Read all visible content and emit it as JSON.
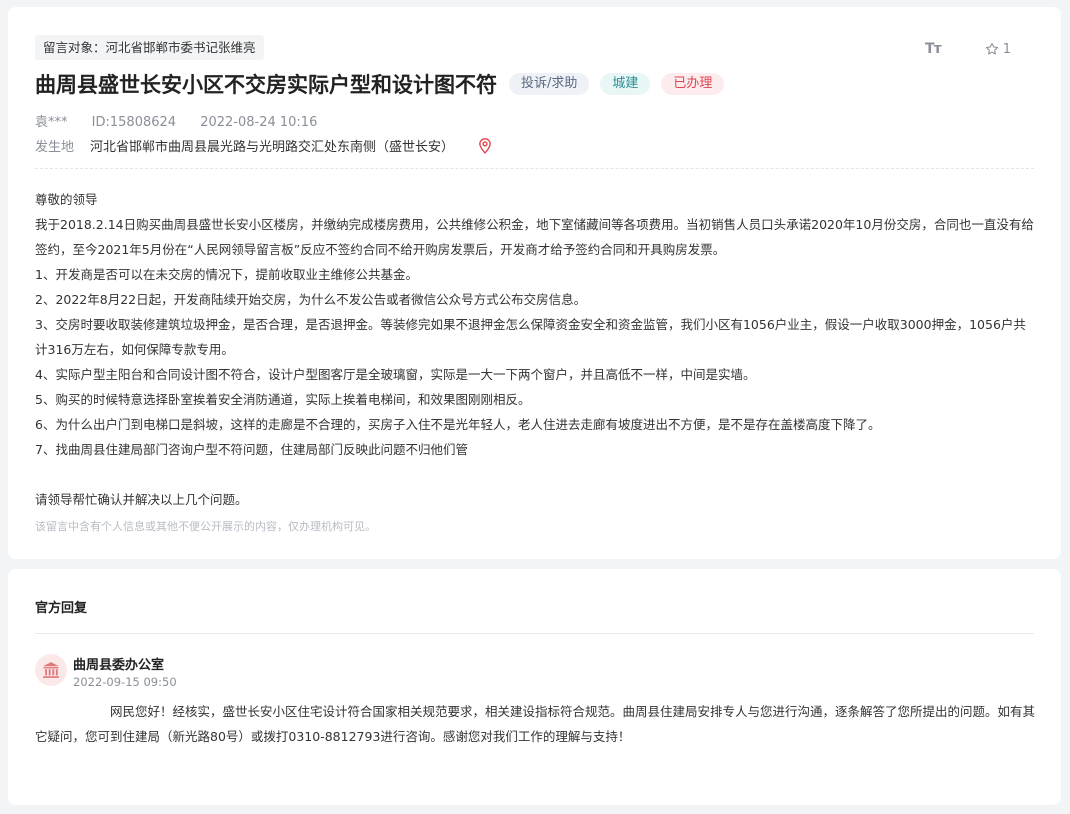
{
  "message": {
    "target_label": "留言对象：河北省邯郸市委书记张维亮",
    "title": "曲周县盛世长安小区不交房实际户型和设计图不符",
    "tags": [
      "投诉/求助",
      "城建",
      "已办理"
    ],
    "author": "袁***",
    "id_text": "ID:15808624",
    "datetime": "2022-08-24 10:16",
    "location_label": "发生地",
    "location": "河北省邯郸市曲周县晨光路与光明路交汇处东南侧（盛世长安）",
    "paragraphs": [
      "尊敬的领导",
      "我于2018.2.14日购买曲周县盛世长安小区楼房，并缴纳完成楼房费用，公共维修公积金，地下室储藏间等各项费用。当初销售人员口头承诺2020年10月份交房，合同也一直没有给签约，至今2021年5月份在“人民网领导留言板”反应不签约合同不给开购房发票后，开发商才给予签约合同和开具购房发票。",
      "1、开发商是否可以在未交房的情况下，提前收取业主维修公共基金。",
      "2、2022年8月22日起，开发商陆续开始交房，为什么不发公告或者微信公众号方式公布交房信息。",
      "3、交房时要收取装修建筑垃圾押金，是否合理，是否退押金。等装修完如果不退押金怎么保障资金安全和资金监管，我们小区有1056户业主，假设一户收取3000押金，1056户共计316万左右，如何保障专款专用。",
      "4、实际户型主阳台和合同设计图不符合，设计户型图客厅是全玻璃窗，实际是一大一下两个窗户，并且高低不一样，中间是实墙。",
      "5、购买的时候特意选择卧室挨着安全消防通道，实际上挨着电梯间，和效果图刚刚相反。",
      "6、为什么出户门到电梯口是斜坡，这样的走廊是不合理的，买房子入住不是光年轻人，老人住进去走廊有坡度进出不方便，是不是存在盖楼高度下降了。",
      "7、找曲周县住建局部门咨询户型不符问题，住建局部门反映此问题不归他们管"
    ],
    "closing": "请领导帮忙确认并解决以上几个问题。",
    "privacy_notice": "该留言中含有个人信息或其他不便公开展示的内容，仅办理机构可见。"
  },
  "toolbar": {
    "font_icon_label": "Tт",
    "favorite_count": "1"
  },
  "reply": {
    "heading": "官方回复",
    "org_name": "曲周县委办公室",
    "datetime": "2022-09-15 09:50",
    "text": "网民您好！经核实，盛世长安小区住宅设计符合国家相关规范要求，相关建设指标符合规范。曲周县住建局安排专人与您进行沟通，逐条解答了您所提出的问题。如有其它疑问，您可到住建局（新光路80号）或拨打0310-8812793进行咨询。感谢您对我们工作的理解与支持！"
  },
  "colors": {
    "accent_red": "#e0444f",
    "teal": "#2b8f95",
    "muted": "#8a8f99"
  }
}
